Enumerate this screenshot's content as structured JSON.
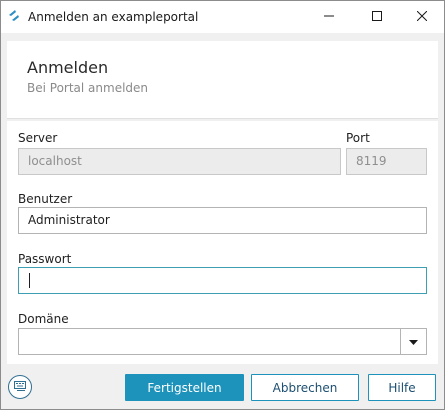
{
  "window": {
    "title": "Anmelden an exampleportal",
    "icon": "app-logo-icon",
    "controls": [
      "minimize-icon",
      "maximize-icon",
      "close-icon"
    ]
  },
  "header": {
    "title": "Anmelden",
    "subtitle": "Bei Portal anmelden"
  },
  "form": {
    "server": {
      "label": "Server",
      "value": "localhost",
      "disabled": true
    },
    "port": {
      "label": "Port",
      "value": "8119",
      "disabled": true
    },
    "user": {
      "label": "Benutzer",
      "value": "Administrator"
    },
    "password": {
      "label": "Passwort",
      "value": ""
    },
    "domain": {
      "label": "Domäne",
      "value": "",
      "icon": "chevron-down-icon"
    }
  },
  "footer": {
    "help_toggle_icon": "keyboard-icon",
    "finish_label": "Fertigstellen",
    "cancel_label": "Abbrechen",
    "help_label": "Hilfe"
  },
  "colors": {
    "accent": "#1d93bb",
    "focus_border": "#3e9fb2",
    "window_bg": "#f0f0f0",
    "panel_bg": "#ffffff"
  }
}
